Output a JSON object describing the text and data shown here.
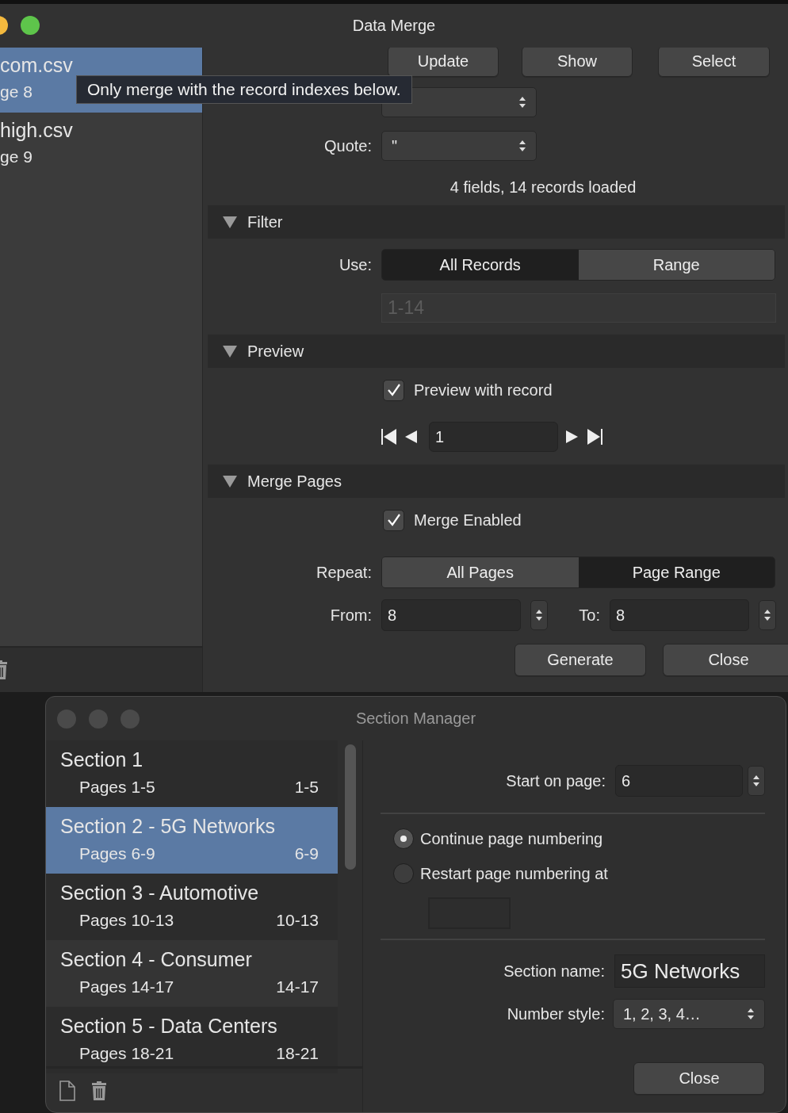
{
  "data_merge": {
    "window": {
      "title": "Data Merge"
    },
    "sources": [
      {
        "name": "com.csv",
        "page": "ge 8",
        "selected": true
      },
      {
        "name": "high.csv",
        "page": "ge 9",
        "selected": false
      }
    ],
    "toolbar_buttons": [
      "Update",
      "Show",
      "Select"
    ],
    "tooltip": "Only merge with the record indexes below.",
    "quote": {
      "label": "Quote:",
      "value": "\""
    },
    "status": "4 fields, 14 records loaded",
    "filter": {
      "title": "Filter",
      "expanded": true,
      "use_label": "Use:",
      "options": [
        {
          "label": "All Records",
          "selected": true
        },
        {
          "label": "Range",
          "selected": false
        }
      ],
      "range": {
        "value": "1-14",
        "disabled": true
      }
    },
    "preview": {
      "title": "Preview",
      "expanded": true,
      "checkbox": {
        "label": "Preview with record",
        "checked": true
      },
      "record": "1"
    },
    "merge_pages": {
      "title": "Merge Pages",
      "expanded": true,
      "checkbox": {
        "label": "Merge Enabled",
        "checked": true
      },
      "repeat_label": "Repeat:",
      "options": [
        {
          "label": "All Pages",
          "selected": false
        },
        {
          "label": "Page Range",
          "selected": true
        }
      ],
      "from": {
        "label": "From:",
        "value": "8"
      },
      "to": {
        "label": "To:",
        "value": "8"
      }
    },
    "buttons": [
      "Generate",
      "Close"
    ]
  },
  "section_manager": {
    "window": {
      "title": "Section Manager"
    },
    "sections": [
      {
        "name": "Section 1",
        "pages": "Pages 1-5",
        "range": "1-5",
        "selected": false
      },
      {
        "name": "Section 2 - 5G Networks",
        "pages": "Pages 6-9",
        "range": "6-9",
        "selected": true
      },
      {
        "name": "Section 3 - Automotive",
        "pages": "Pages 10-13",
        "range": "10-13",
        "selected": false
      },
      {
        "name": "Section 4 - Consumer",
        "pages": "Pages 14-17",
        "range": "14-17",
        "selected": false
      },
      {
        "name": "Section 5 - Data Centers",
        "pages": "Pages 18-21",
        "range": "18-21",
        "selected": false
      }
    ],
    "start_on_page": {
      "label": "Start on page:",
      "value": "6"
    },
    "numbering": [
      {
        "label": "Continue page numbering",
        "selected": true
      },
      {
        "label": "Restart page numbering at",
        "selected": false
      }
    ],
    "section_name": {
      "label": "Section name:",
      "value": "5G Networks"
    },
    "number_style": {
      "label": "Number style:",
      "value": "1, 2, 3, 4…"
    },
    "buttons": [
      "Close"
    ]
  }
}
